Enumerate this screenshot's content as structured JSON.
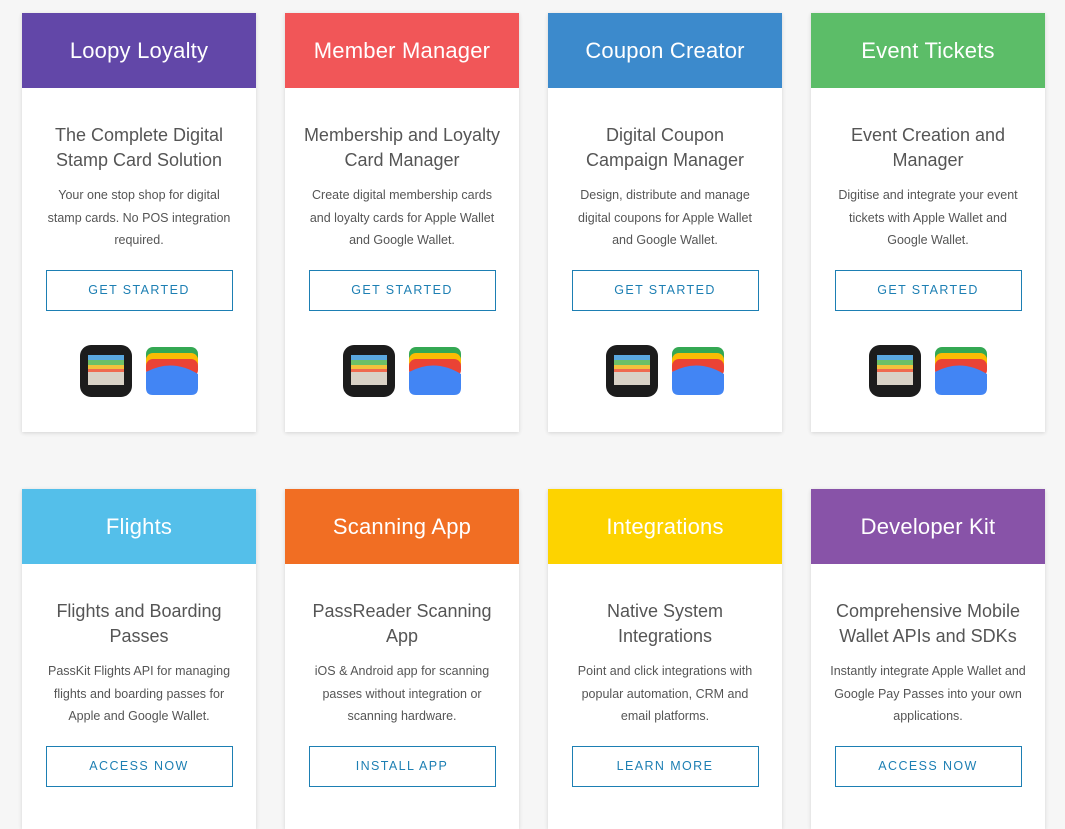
{
  "cards": [
    {
      "title": "Loopy Loyalty",
      "color": "#6247a8",
      "subtitle": "The Complete Digital Stamp Card Solution",
      "description": "Your one stop shop for digital stamp cards. No POS integration required.",
      "button": "GET STARTED",
      "icons": [
        "apple-wallet-icon",
        "google-wallet-icon"
      ]
    },
    {
      "title": "Member Manager",
      "color": "#f15658",
      "subtitle": "Membership and Loyalty Card Manager",
      "description": "Create digital membership cards and loyalty cards for Apple Wallet and Google Wallet.",
      "button": "GET STARTED",
      "icons": [
        "apple-wallet-icon",
        "google-wallet-icon"
      ]
    },
    {
      "title": "Coupon Creator",
      "color": "#3c8acc",
      "subtitle": "Digital Coupon Campaign Manager",
      "description": "Design, distribute and manage digital coupons for Apple Wallet and Google Wallet.",
      "button": "GET STARTED",
      "icons": [
        "apple-wallet-icon",
        "google-wallet-icon"
      ]
    },
    {
      "title": "Event Tickets",
      "color": "#5cbd68",
      "subtitle": "Event Creation and Manager",
      "description": "Digitise and integrate your event tickets with Apple Wallet and Google Wallet.",
      "button": "GET STARTED",
      "icons": [
        "apple-wallet-icon",
        "google-wallet-icon"
      ]
    },
    {
      "title": "Flights",
      "color": "#54bfea",
      "subtitle": "Flights and Boarding Passes",
      "description": "PassKit Flights API for managing flights and boarding passes for Apple and Google Wallet.",
      "button": "ACCESS NOW"
    },
    {
      "title": "Scanning App",
      "color": "#f16e23",
      "subtitle": "PassReader Scanning App",
      "description": "iOS & Android app for scanning passes without integration or scanning hardware.",
      "button": "INSTALL APP"
    },
    {
      "title": "Integrations",
      "color": "#fdd300",
      "subtitle": "Native System Integrations",
      "description": "Point and click integrations with popular automation, CRM and email platforms.",
      "button": "LEARN MORE"
    },
    {
      "title": "Developer Kit",
      "color": "#8853a8",
      "subtitle": "Comprehensive Mobile Wallet APIs and SDKs",
      "description": "Instantly integrate Apple Wallet and Google Pay Passes into your own applications.",
      "button": "ACCESS NOW"
    }
  ],
  "accent_color": "#1d7fb3"
}
